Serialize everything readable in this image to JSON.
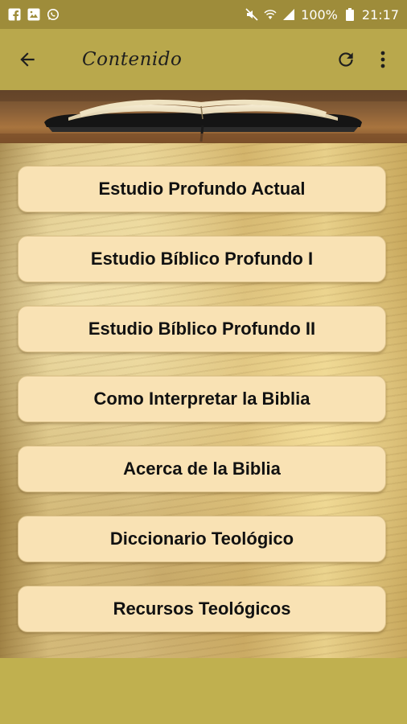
{
  "status_bar": {
    "battery_percent": "100%",
    "time": "21:17",
    "left_icons": [
      "facebook-icon",
      "gallery-icon",
      "whatsapp-icon"
    ],
    "right_icons": [
      "mute-icon",
      "wifi-icon",
      "signal-icon",
      "battery-icon"
    ]
  },
  "app_bar": {
    "title": "Contenido",
    "back_icon": "arrow-left-icon",
    "refresh_icon": "refresh-icon",
    "more_icon": "more-vert-icon"
  },
  "menu": [
    {
      "label": "Estudio Profundo Actual"
    },
    {
      "label": "Estudio Bíblico Profundo I"
    },
    {
      "label": "Estudio Bíblico Profundo II"
    },
    {
      "label": "Como Interpretar la Biblia"
    },
    {
      "label": "Acerca de la Biblia"
    },
    {
      "label": "Diccionario Teológico"
    },
    {
      "label": "Recursos Teológicos"
    }
  ],
  "colors": {
    "app_bar": "#b9a84c",
    "status_bar": "#9e8c3a",
    "button_bg": "#f9e2b4",
    "bottom_band": "#c0b04f"
  }
}
